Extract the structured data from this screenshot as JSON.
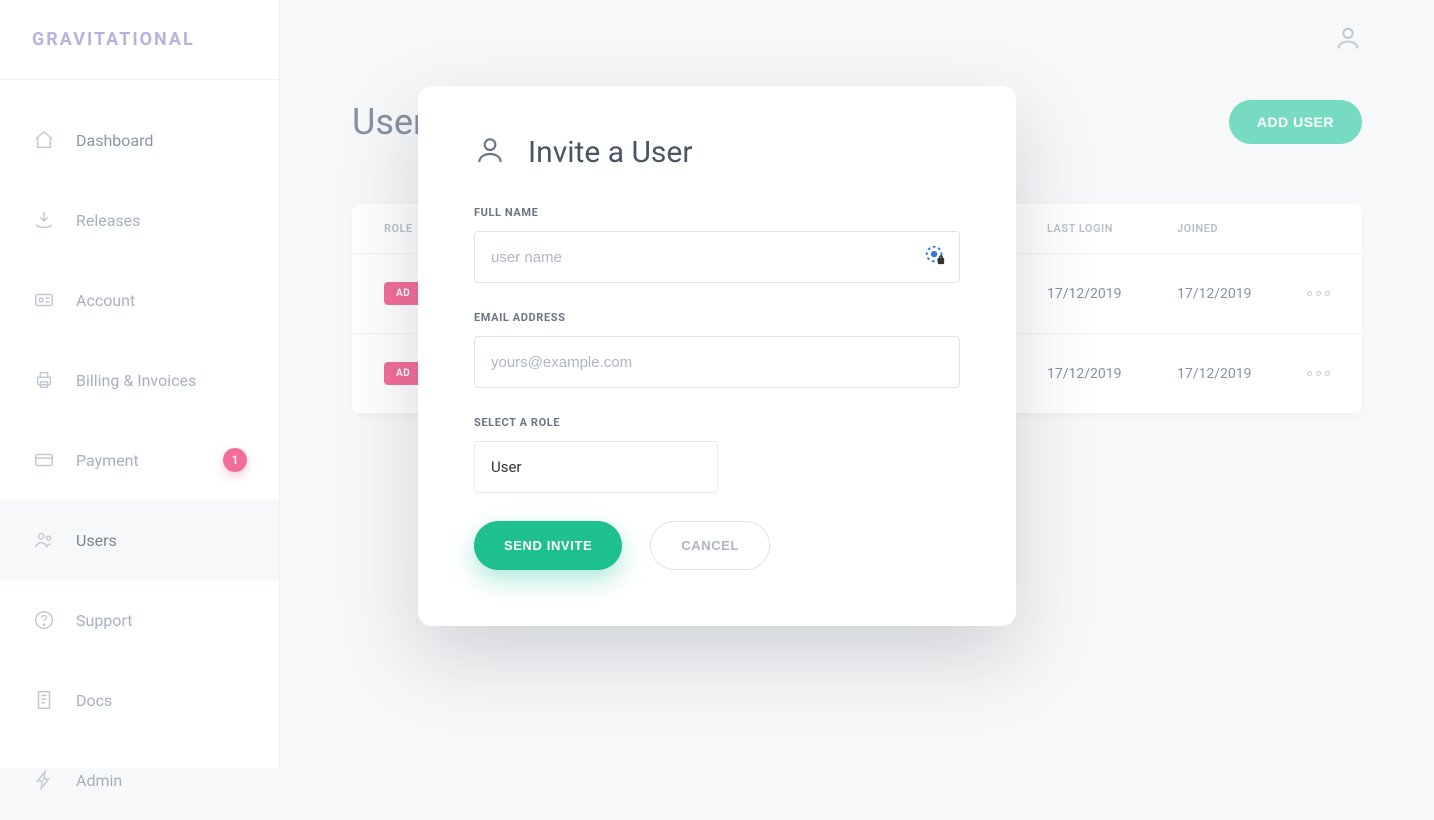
{
  "brand": "GRAVITATIONAL",
  "sidebar": {
    "items": [
      {
        "label": "Dashboard",
        "icon": "home-icon",
        "badge": null
      },
      {
        "label": "Releases",
        "icon": "download-icon",
        "badge": null
      },
      {
        "label": "Account",
        "icon": "id-card-icon",
        "badge": null
      },
      {
        "label": "Billing & Invoices",
        "icon": "printer-icon",
        "badge": null
      },
      {
        "label": "Payment",
        "icon": "credit-card-icon",
        "badge": "1"
      },
      {
        "label": "Users",
        "icon": "users-icon",
        "badge": null,
        "active": true
      },
      {
        "label": "Support",
        "icon": "help-icon",
        "badge": null
      },
      {
        "label": "Docs",
        "icon": "doc-icon",
        "badge": null
      },
      {
        "label": "Admin",
        "icon": "bolt-icon",
        "badge": null
      }
    ]
  },
  "page": {
    "title": "Users",
    "add_user_label": "ADD USER"
  },
  "table": {
    "columns": {
      "role": "ROLE",
      "last_login": "LAST LOGIN",
      "joined": "JOINED"
    },
    "rows": [
      {
        "role": "AD",
        "last_login": "17/12/2019",
        "joined": "17/12/2019"
      },
      {
        "role": "AD",
        "last_login": "17/12/2019",
        "joined": "17/12/2019"
      }
    ]
  },
  "modal": {
    "title": "Invite a User",
    "fields": {
      "full_name_label": "FULL NAME",
      "full_name_placeholder": "user name",
      "email_label": "EMAIL ADDRESS",
      "email_placeholder": "yours@example.com",
      "role_label": "SELECT A ROLE",
      "role_value": "User"
    },
    "actions": {
      "submit": "SEND INVITE",
      "cancel": "CANCEL"
    }
  }
}
